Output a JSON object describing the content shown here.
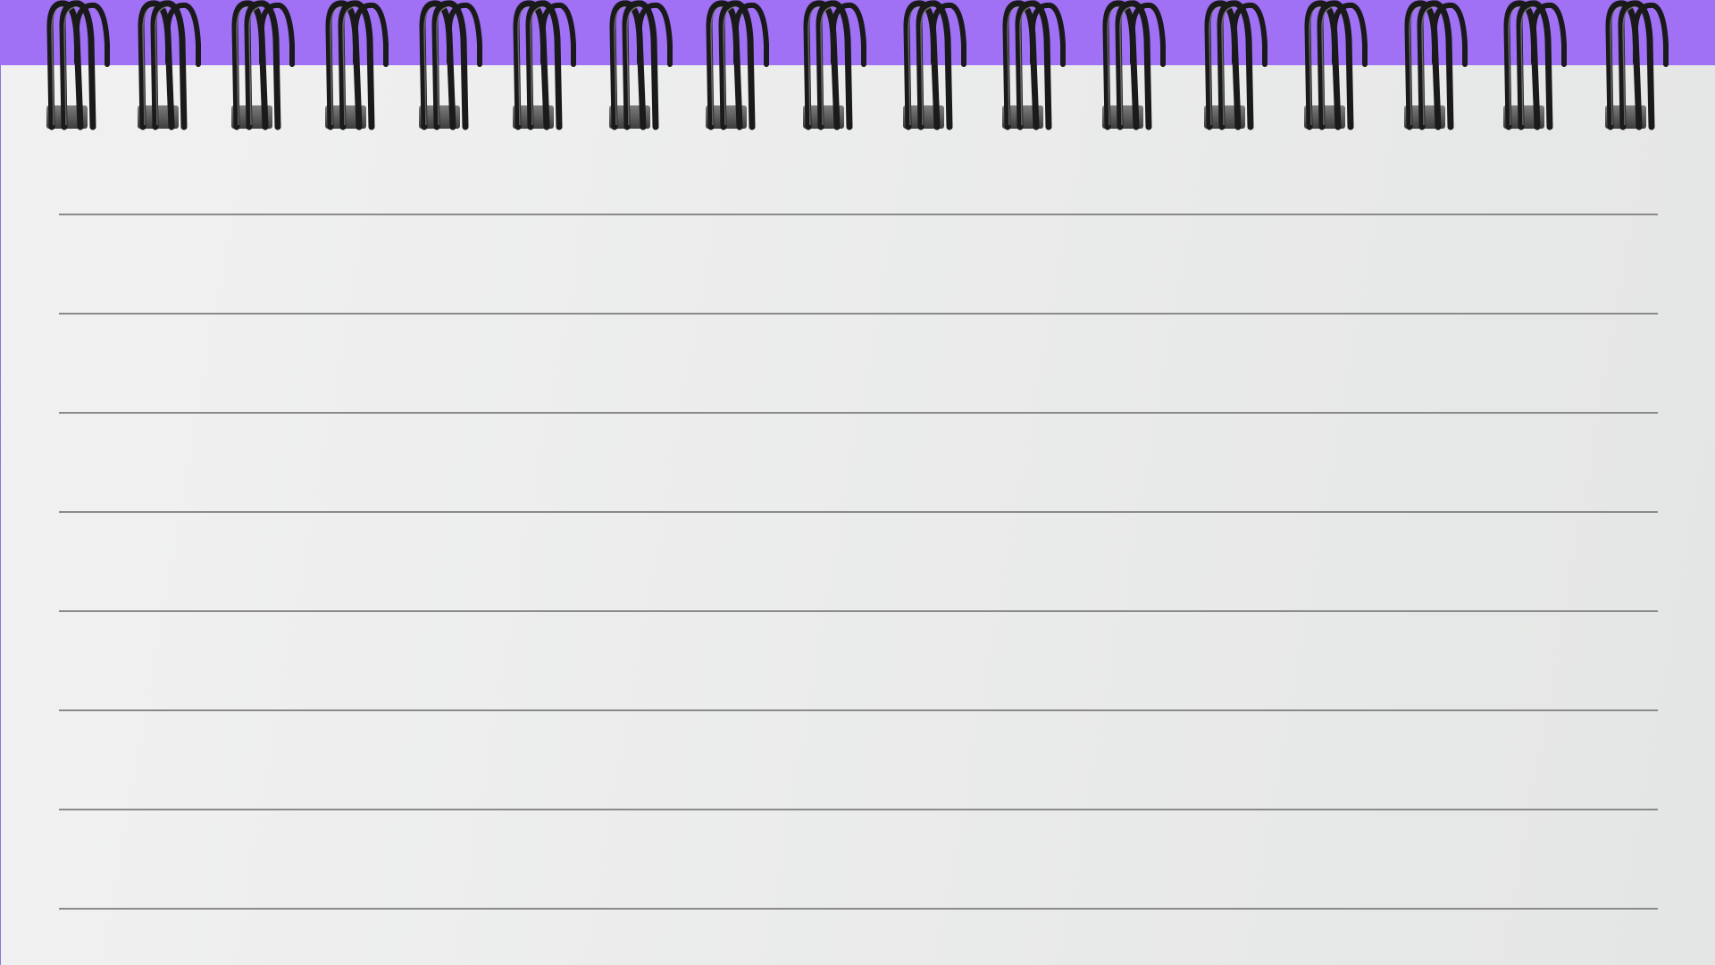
{
  "notebook": {
    "binding_color": "#a070f5",
    "paper_color_light": "#f1f1f1",
    "paper_color_dark": "#e4e6e5",
    "line_color": "#8a8a8a",
    "ring_color": "#1a1a1a",
    "ring_count": 17,
    "ruled_line_count": 8
  }
}
